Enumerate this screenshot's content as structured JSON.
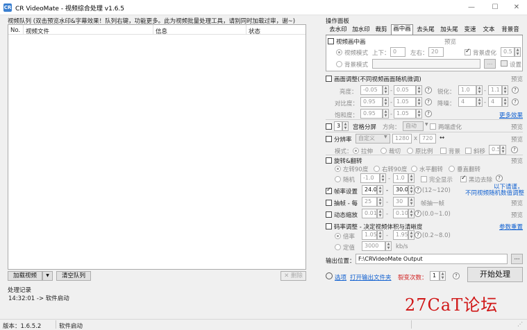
{
  "window": {
    "title": "CR VideoMate - 视频综合处理 v1.6.5",
    "icon_letter": "CR",
    "min": "—",
    "max": "☐",
    "close": "✕"
  },
  "queue": {
    "label": "视频队列 (双击预览水印&字幕效果！队列右键，功能更多。此为视频批量处理工具，请别同时加载过审，谢~)",
    "columns": [
      "No.",
      "视频文件",
      "信息",
      "状态"
    ]
  },
  "buttons": {
    "load": "加载视频",
    "load_menu": "▼",
    "clear": "清空队列",
    "delete": "✕ 删除",
    "start": "开始处理",
    "browse": "..."
  },
  "log": {
    "label": "处理记录",
    "entry": "14:32:01 -> 软件启动"
  },
  "status": {
    "version": "版本：1.6.5.2",
    "state": "软件启动"
  },
  "panel": {
    "label": "操作面板",
    "tabs": [
      "去水印",
      "加水印",
      "裁剪",
      "画中画",
      "去头尾",
      "加头尾",
      "变速",
      "文本",
      "背景音"
    ],
    "active_tab": "画中画"
  },
  "pip": {
    "title": "视频画中画",
    "preview": "预览",
    "video_mode": "视频模式",
    "updown": "上下：",
    "updown_val": "0",
    "leftright": "左右：",
    "leftright_val": "20",
    "bg_blur": "背景虚化",
    "bg_blur_val": "0.5",
    "bg_mode": "背景模式",
    "settings": "设置",
    "browse": "..."
  },
  "adjust": {
    "title": "画面调整(不同视频画面随机微调)",
    "preview": "预览",
    "brightness": "亮度：",
    "b1": "-0.05",
    "b2": "0.05",
    "sharpen": "锐化：",
    "s1": "1.0",
    "s2": "1.1",
    "contrast": "对比度：",
    "c1": "0.95",
    "c2": "1.05",
    "denoise": "降噪：",
    "d1": "4",
    "d2": "4",
    "saturation": "饱和度：",
    "sa1": "0.95",
    "sa2": "1.05",
    "more": "更多效果"
  },
  "grid": {
    "num": "3",
    "label": "宫格分屏",
    "dir": "方向：",
    "dir_val": "自动",
    "blur": "两端虚化",
    "preview": "预览"
  },
  "resolution": {
    "title": "分辨率",
    "preset": "自定义",
    "w": "1280",
    "x": "x",
    "h": "720",
    "swap": "↔",
    "mode": "模式：",
    "stretch": "拉伸",
    "crop": "裁切",
    "ratio": "原比例",
    "bg": "背景",
    "tilt": "斜移",
    "tilt_val": "0.5",
    "preview": "预览"
  },
  "rotate": {
    "title": "旋转&翻转",
    "preview": "预览",
    "left90": "左转90度",
    "right90": "右转90度",
    "hflip": "水平翻转",
    "vflip": "垂直翻转",
    "random": "随机",
    "r1": "-1.0",
    "r2": "1.0",
    "full": "完全显示",
    "blackedge": "黑边去除"
  },
  "framerate": {
    "title": "帧率设置",
    "f1": "24.0",
    "f2": "30.0",
    "range": "(12~120)",
    "note1": "以下请谨，",
    "note2": "不同视频随机数值调整"
  },
  "extract": {
    "title": "抽帧 - 每",
    "e1": "25",
    "e2": "30",
    "unit": "帧抽一帧",
    "preview": "预览"
  },
  "zoom": {
    "title": "动态缩放",
    "z1": "0.01",
    "z2": "0.10",
    "range": "(0.0~1.0)",
    "preview": "预览"
  },
  "bitrate": {
    "title": "码率调整 - 决定视频体积与清晰度",
    "reset": "参数重置",
    "mult": "倍率",
    "m1": "1.05",
    "m2": "1.95",
    "range": "(0.2~8.0)",
    "fixed": "定值",
    "fixed_val": "3000",
    "unit": "kb/s"
  },
  "output": {
    "label": "输出位置：",
    "path": "F:\\CRVideoMate Output"
  },
  "footer": {
    "options": "选项",
    "open_folder": "打开输出文件夹",
    "split": "裂变次数：",
    "split_val": "1"
  },
  "watermark": "27CaT论坛"
}
